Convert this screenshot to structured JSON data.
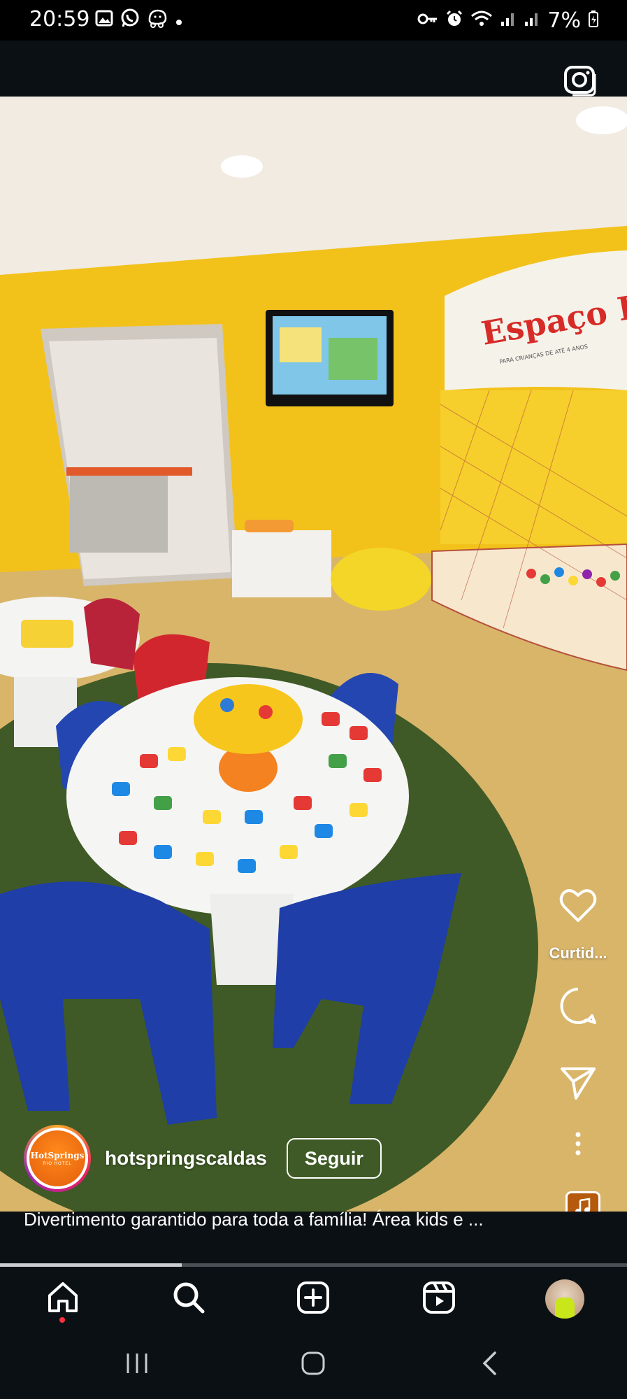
{
  "status_bar": {
    "time": "20:59",
    "left_icons": [
      "gallery-icon",
      "whatsapp-icon",
      "waze-icon",
      "dot-icon"
    ],
    "right_icons": [
      "key-icon",
      "alarm-icon",
      "wifi-icon",
      "signal-icon",
      "signal-icon",
      "battery-icon"
    ],
    "battery": "7%"
  },
  "header": {
    "camera_icon": "camera-icon"
  },
  "reel": {
    "sign_text": "Espaço Ba",
    "sign_subtext": "PARA CRIANÇAS DE ATÉ 4 ANOS",
    "author": {
      "username": "hotspringscaldas",
      "avatar_text": "HotSprings",
      "avatar_subtext": "RIO HOTEL",
      "follow_label": "Seguir"
    },
    "caption": "Divertimento garantido para toda a família! Área kids e ...",
    "progress": 0.29,
    "actions": [
      {
        "icon": "heart-icon",
        "label": "Curtid..."
      },
      {
        "icon": "comment-icon",
        "label": ""
      },
      {
        "icon": "share-icon",
        "label": ""
      },
      {
        "icon": "more-icon",
        "label": ""
      }
    ],
    "music_icon": "music-icon"
  },
  "bottom_nav": {
    "items": [
      "home-icon",
      "search-icon",
      "create-icon",
      "reels-icon",
      "profile-avatar"
    ]
  },
  "system_nav": {
    "items": [
      "recents-icon",
      "home-button-icon",
      "back-icon"
    ]
  },
  "colors": {
    "background": "#0b1014",
    "accent_notification": "#ff3040",
    "wall": "#f2c21b",
    "carpet": "#3f5a26"
  }
}
